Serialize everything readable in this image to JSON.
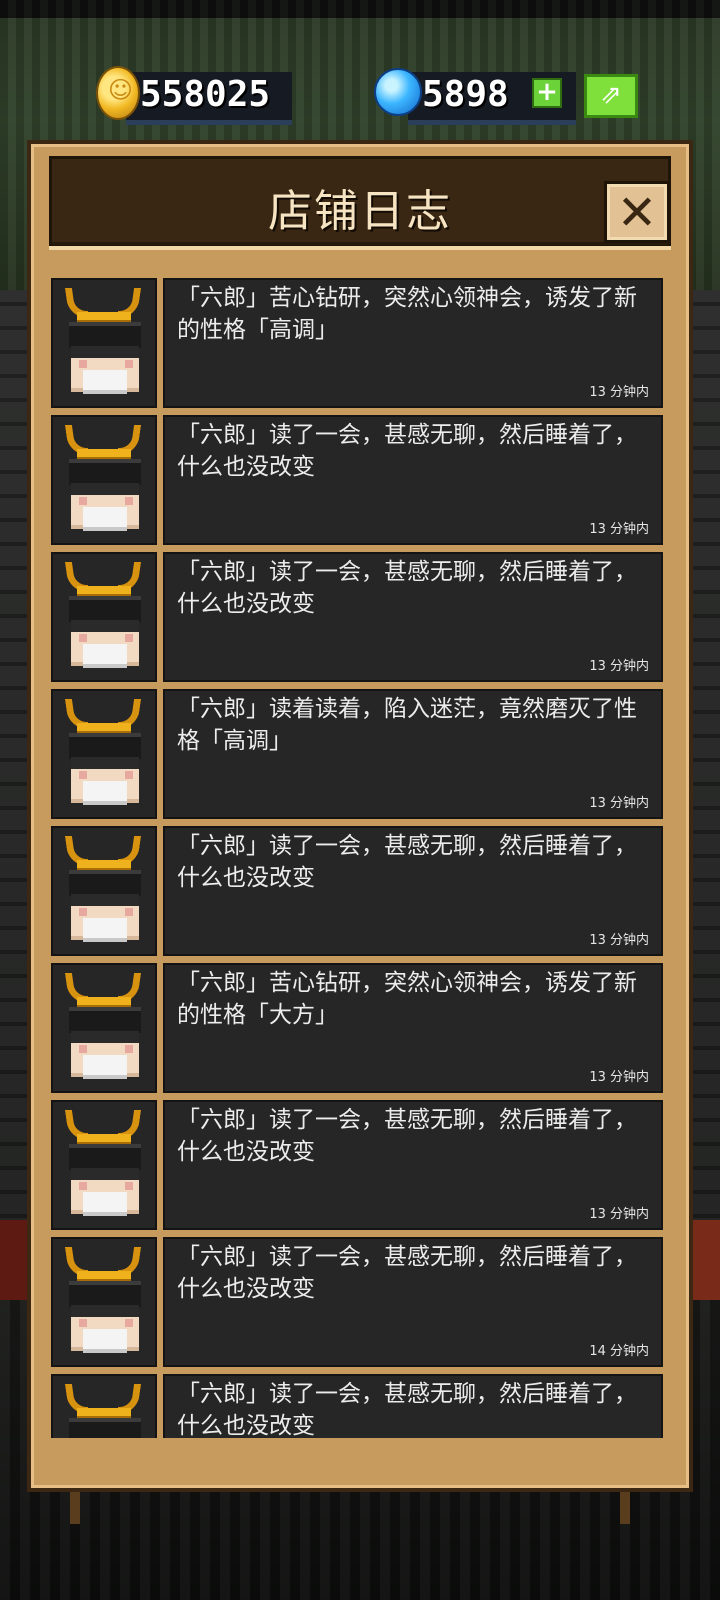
{
  "currency": {
    "coins": "558025",
    "gems": "5898",
    "plus_label": "+",
    "coin_icon": "coin-icon",
    "gem_icon": "gem-icon"
  },
  "dialog": {
    "title": "店铺日志",
    "close_label": "✕"
  },
  "log_entries": [
    {
      "text": "「六郎」苦心钻研，突然心领神会，诱发了新的性格「高调」",
      "time": "13 分钟内"
    },
    {
      "text": "「六郎」读了一会，甚感无聊，然后睡着了，什么也没改变",
      "time": "13 分钟内"
    },
    {
      "text": "「六郎」读了一会，甚感无聊，然后睡着了，什么也没改变",
      "time": "13 分钟内"
    },
    {
      "text": "「六郎」读着读着，陷入迷茫，竟然磨灭了性格「高调」",
      "time": "13 分钟内"
    },
    {
      "text": "「六郎」读了一会，甚感无聊，然后睡着了，什么也没改变",
      "time": "13 分钟内"
    },
    {
      "text": "「六郎」苦心钻研，突然心领神会，诱发了新的性格「大方」",
      "time": "13 分钟内"
    },
    {
      "text": "「六郎」读了一会，甚感无聊，然后睡着了，什么也没改变",
      "time": "13 分钟内"
    },
    {
      "text": "「六郎」读了一会，甚感无聊，然后睡着了，什么也没改变",
      "time": "14 分钟内"
    },
    {
      "text": "「六郎」读了一会，甚感无聊，然后睡着了，什么也没改变",
      "time": ""
    }
  ]
}
